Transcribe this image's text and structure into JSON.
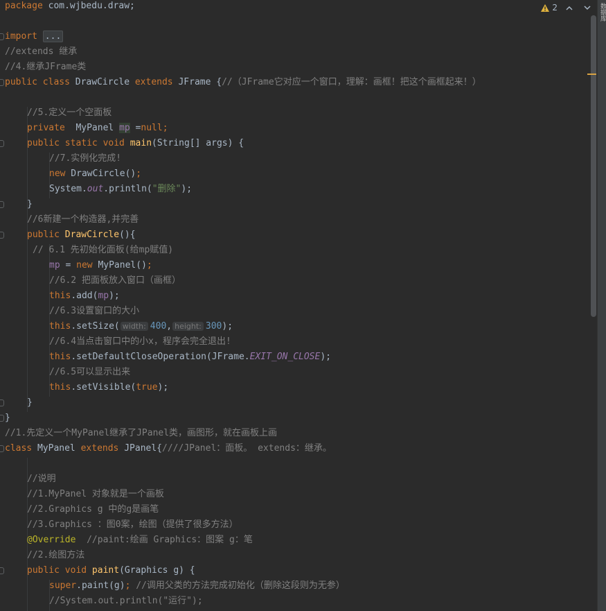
{
  "inspection": {
    "warning_count": "2",
    "up_label": "∧",
    "down_label": "∨"
  },
  "right_strip": {
    "label": "数据库"
  },
  "code": {
    "l1": {
      "kw": "package",
      "rest": " com.wjbedu.draw;"
    },
    "l3": {
      "kw": "import",
      "fold": "..."
    },
    "l4": "//extends 继承",
    "l5": "//4.继承JFrame类",
    "l6": {
      "kw1": "public class",
      "name": " DrawCircle ",
      "kw2": "extends",
      "rest": " JFrame {",
      "cm": "//（JFrame它对应一个窗口，理解：画框！把这个画框起来！）"
    },
    "l8": "//5.定义一个空面板",
    "l9": {
      "kw": "private",
      "type": "  MyPanel ",
      "var": "mp",
      "eq": " =",
      "null": "null",
      "semi": ";"
    },
    "l10": {
      "kw": "public static void",
      "fn": "main",
      "rest": "(String[] args) {"
    },
    "l11": "//7.实例化完成!",
    "l12": {
      "kw": "new",
      "rest": " DrawCircle()",
      "semi": ";"
    },
    "l13": {
      "pre": "System.",
      "st": "out",
      "mid": ".println(",
      "str": "\"删除\"",
      "post": ");"
    },
    "l14": "}",
    "l15": "//6新建一个构造器,并完善",
    "l16": {
      "kw": "public",
      "fn": " DrawCircle",
      "rest": "(){"
    },
    "l17": "// 6.1 先初始化面板(给mp赋值)",
    "l18": {
      "var": "mp",
      "eq": " = ",
      "kw": "new",
      "rest": " MyPanel()",
      "semi": ";"
    },
    "l19": "//6.2 把面板放入窗口（画框）",
    "l20": {
      "kw": "this",
      "mid": ".add(",
      "var": "mp",
      "post": ");"
    },
    "l21": "//6.3设置窗口的大小",
    "l22": {
      "kw": "this",
      "mid": ".setSize(",
      "hint1": "width:",
      "num1": "400",
      "comma": ",",
      "hint2": "height:",
      "num2": "300",
      "post": ");"
    },
    "l23": "//6.4当点击窗口中的小x，程序会完全退出!",
    "l24": {
      "kw": "this",
      "mid": ".setDefaultCloseOperation(JFrame.",
      "st": "EXIT_ON_CLOSE",
      "post": ");"
    },
    "l25": "//6.5可以显示出来",
    "l26": {
      "kw": "this",
      "mid": ".setVisible(",
      "kw2": "true",
      "post": ");"
    },
    "l27": "}",
    "l28": "}",
    "l29": "//1.先定义一个MyPanel继承了JPanel类，画图形，就在画板上画",
    "l30": {
      "kw1": "class",
      "name": " MyPanel ",
      "kw2": "extends",
      "rest": " JPanel{",
      "cm": "////JPanel：面板。 extends：继承。"
    },
    "l32": "//说明",
    "l33": "//1.MyPanel 对象就是一个画板",
    "l34": "//2.Graphics g 中的g是画笔",
    "l35": "//3.Graphics ：图0案，绘图（提供了很多方法）",
    "l36": {
      "ann": "@Override",
      "cm": "  //paint:绘画 Graphics：图案 g：笔"
    },
    "l37": "//2.绘图方法",
    "l38": {
      "kw": "public void",
      "fn": " paint",
      "rest": "(Graphics g) {"
    },
    "l39": {
      "kw": "super",
      "mid": ".paint(g)",
      "semi": ";",
      "cm": " //调用父类的方法完成初始化（删除这段则为无参）"
    },
    "l40": "//System.out.println(\"运行\");"
  }
}
